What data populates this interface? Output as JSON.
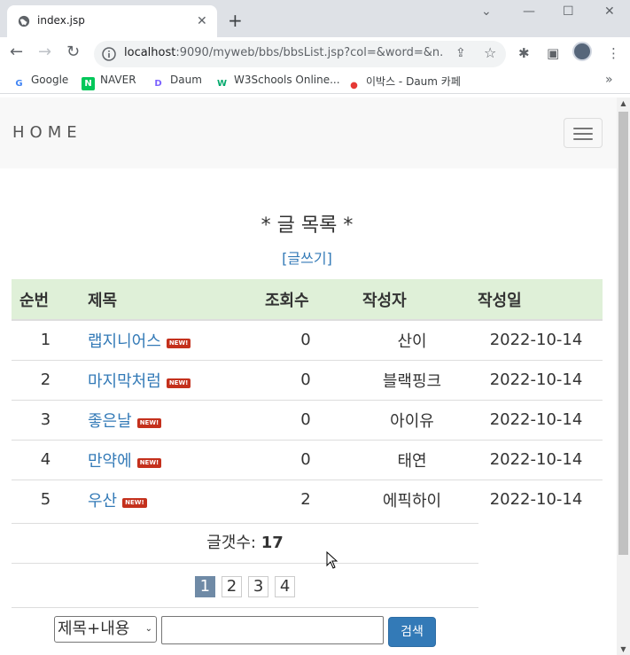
{
  "browser": {
    "tab_title": "index.jsp",
    "tab_close": "✕",
    "new_tab": "+",
    "url_host": "localhost",
    "url_path": ":9090/myweb/bbs/bbsList.jsp?col=&word=&n...",
    "window_controls": {
      "minimize": "—",
      "maximize": "☐",
      "close": "✕",
      "dropdown": "⌄"
    },
    "bookmarks": [
      {
        "label": "Google",
        "icon": "G",
        "color": "#4285f4"
      },
      {
        "label": "NAVER",
        "icon": "N",
        "color": "#03c75a"
      },
      {
        "label": "Daum",
        "icon": "D",
        "color": "#7b61ff"
      },
      {
        "label": "W3Schools Online...",
        "icon": "W",
        "color": "#04aa6d"
      },
      {
        "label": "이박스 - Daum 카페",
        "icon": "●",
        "color": "#e53935"
      }
    ],
    "bookmarks_more": "»"
  },
  "navbar": {
    "brand": "HOME"
  },
  "page": {
    "heading": "* 글 목록 *",
    "write_link": "[글쓰기]"
  },
  "table": {
    "headers": {
      "no": "순번",
      "title": "제목",
      "views": "조회수",
      "author": "작성자",
      "date": "작성일"
    },
    "new_badge": "NEW!",
    "rows": [
      {
        "no": "1",
        "title": "랩지니어스",
        "views": "0",
        "author": "산이",
        "date": "2022-10-14"
      },
      {
        "no": "2",
        "title": "마지막처럼",
        "views": "0",
        "author": "블랙핑크",
        "date": "2022-10-14"
      },
      {
        "no": "3",
        "title": "좋은날",
        "views": "0",
        "author": "아이유",
        "date": "2022-10-14"
      },
      {
        "no": "4",
        "title": "만약에",
        "views": "0",
        "author": "태연",
        "date": "2022-10-14"
      },
      {
        "no": "5",
        "title": "우산",
        "views": "2",
        "author": "에픽하이",
        "date": "2022-10-14"
      }
    ]
  },
  "summary": {
    "count_label": "글갯수: ",
    "count_value": "17"
  },
  "pagination": {
    "pages": [
      "1",
      "2",
      "3",
      "4"
    ],
    "current": "1"
  },
  "search": {
    "selected_option": "제목+내용",
    "input_value": "",
    "button_label": "검색"
  },
  "colors": {
    "link": "#337ab7",
    "header_bg": "#dff0d8",
    "new_badge": "#c4301c",
    "active_page": "#6f8aa6",
    "button": "#337ab7"
  }
}
